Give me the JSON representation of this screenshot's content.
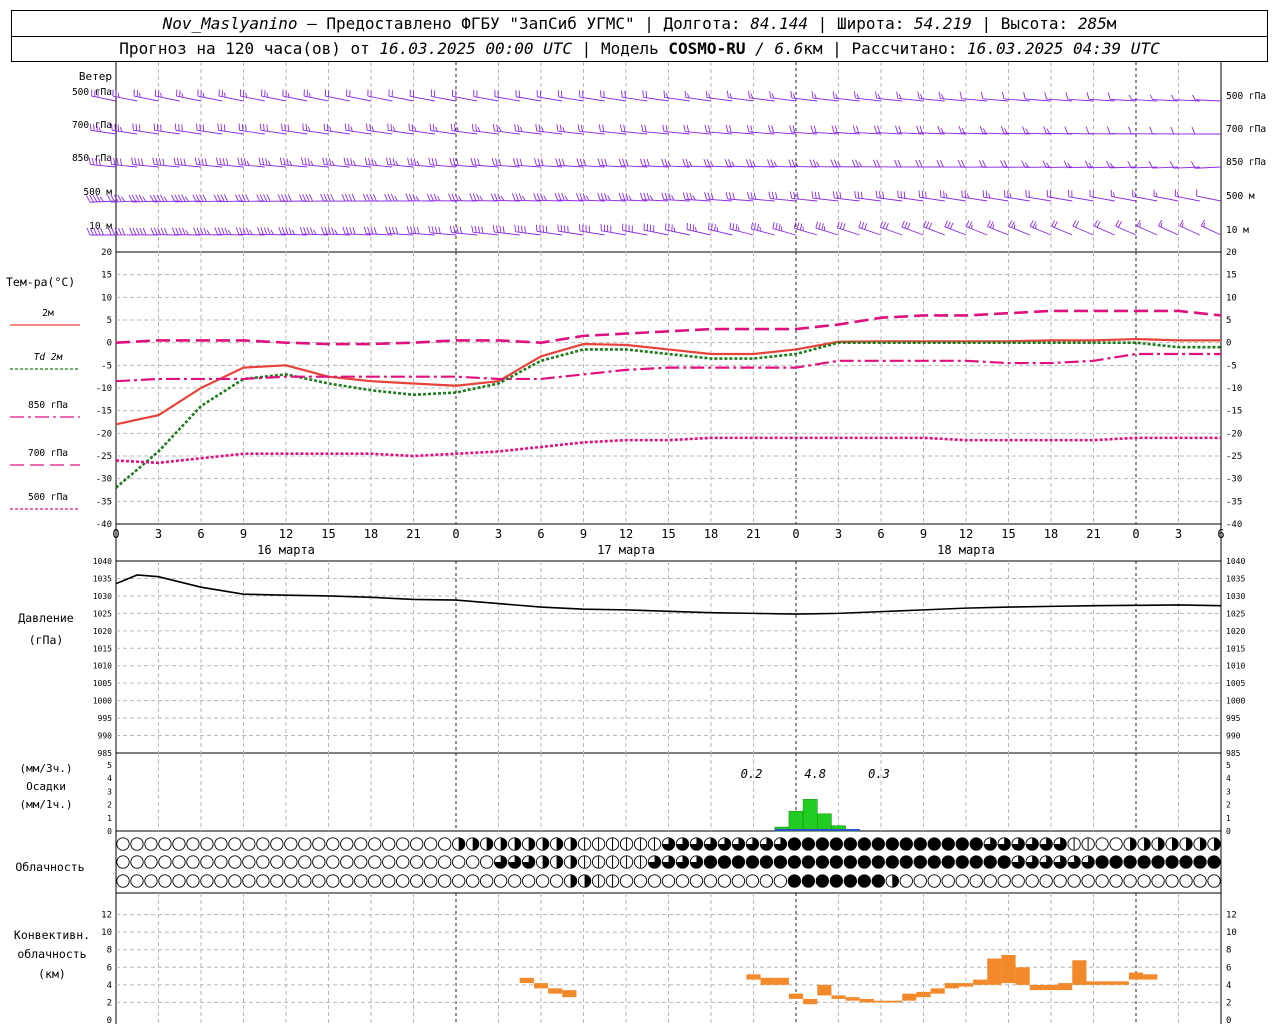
{
  "header": {
    "station": "Nov_Maslyanino",
    "provider": "Предоставлено ФГБУ \"ЗапСиб УГМС\"",
    "lon_label": "Долгота:",
    "lon_value": "84.144",
    "lat_label": "Широта:",
    "lat_value": "54.219",
    "alt_label": "Высота:",
    "alt_value": "285",
    "alt_unit": "м",
    "forecast_label": "Прогноз на 120 часа(ов) от",
    "forecast_start": "16.03.2025 00:00 UTC",
    "model_label": "Модель",
    "model_name": "COSMO-RU",
    "model_res": "/ 6.6",
    "model_res_unit": "км",
    "computed_label": "Рассчитано:",
    "computed_time": "16.03.2025 04:39 UTC"
  },
  "colors": {
    "wind": "#8a2be2",
    "t2m": "#e8433a",
    "td2m": "#1e7b1e",
    "t850": "#e0117f",
    "t700": "#e0117f",
    "t500": "#e0117f",
    "pressure": "#000000",
    "precip": "#22cc22",
    "precip_mm1h": "#3050d0",
    "convective": "#f28a2c",
    "grid": "#b8b8b8"
  },
  "chart_data": [
    {
      "type": "wind_barbs",
      "title": "Ветер",
      "levels": [
        "500 гПа",
        "700 гПа",
        "850 гПа",
        "500 м",
        "10 м"
      ],
      "time_step_hours": 1.5,
      "hours_range": [
        0,
        78
      ],
      "direction_deg": [
        [
          290,
          285,
          280,
          265,
          270
        ],
        [
          290,
          285,
          280,
          270,
          275
        ],
        [
          285,
          280,
          275,
          275,
          290
        ],
        [
          280,
          275,
          270,
          285,
          305
        ],
        [
          275,
          270,
          265,
          290,
          310
        ]
      ],
      "speed_ms": [
        [
          15,
          18,
          22,
          24,
          26
        ],
        [
          12,
          14,
          18,
          20,
          22
        ],
        [
          10,
          12,
          15,
          18,
          20
        ],
        [
          8,
          10,
          12,
          15,
          16
        ],
        [
          4,
          5,
          6,
          7,
          8
        ]
      ]
    },
    {
      "type": "line",
      "ylabel": "Тем-ра(°C)",
      "ylim": [
        -40,
        20
      ],
      "yticks": [
        20,
        15,
        10,
        5,
        0,
        -5,
        -10,
        -15,
        -20,
        -25,
        -30,
        -35,
        -40
      ],
      "x_tick_labels": [
        "0",
        "3",
        "6",
        "9",
        "12",
        "15",
        "18",
        "21",
        "0",
        "3",
        "6",
        "9",
        "12",
        "15",
        "18",
        "21",
        "0",
        "3",
        "6",
        "9",
        "12",
        "15",
        "18",
        "21",
        "0",
        "3",
        "6"
      ],
      "day_labels": [
        "16 марта",
        "17 марта",
        "18 марта"
      ],
      "x_hours": [
        0,
        3,
        6,
        9,
        12,
        15,
        18,
        21,
        24,
        27,
        30,
        33,
        36,
        39,
        42,
        45,
        48,
        51,
        54,
        57,
        60,
        63,
        66,
        69,
        72,
        75,
        78
      ],
      "series": [
        {
          "name": "2м",
          "values": [
            -18,
            -16,
            -10,
            -5.5,
            -5,
            -7.5,
            -8.5,
            -9,
            -9.5,
            -8.5,
            -3,
            -0.3,
            -0.5,
            -1.5,
            -2.5,
            -2.5,
            -1.5,
            0.2,
            0.3,
            0.3,
            0.3,
            0.3,
            0.5,
            0.5,
            0.8,
            0.5,
            0.5
          ]
        },
        {
          "name": "Td  2м",
          "values": [
            -32,
            -24,
            -14,
            -8,
            -7,
            -9,
            -10.5,
            -11.5,
            -11,
            -9,
            -4,
            -1.5,
            -1.5,
            -2.5,
            -3.5,
            -3.5,
            -2.5,
            0,
            0,
            0,
            0,
            0,
            0,
            0,
            0,
            -1,
            -1
          ]
        },
        {
          "name": "850 гПа",
          "values": [
            -8.5,
            -8,
            -8,
            -8,
            -7.5,
            -7.5,
            -7.5,
            -7.5,
            -7.5,
            -8,
            -8,
            -7,
            -6,
            -5.5,
            -5.5,
            -5.5,
            -5.5,
            -4,
            -4,
            -4,
            -4,
            -4.5,
            -4.5,
            -4,
            -2.5,
            -2.5,
            -2.5
          ]
        },
        {
          "name": "700 гПа",
          "values": [
            0,
            0.5,
            0.5,
            0.5,
            0,
            -0.3,
            -0.3,
            0,
            0.5,
            0.5,
            0,
            1.5,
            2,
            2.5,
            3,
            3,
            3,
            4,
            5.5,
            6,
            6,
            6.5,
            7,
            7,
            7,
            7,
            6
          ]
        },
        {
          "name": "500 гПа",
          "values": [
            -26,
            -26.5,
            -25.5,
            -24.5,
            -24.5,
            -24.5,
            -24.5,
            -25,
            -24.5,
            -24,
            -23,
            -22,
            -21.5,
            -21.5,
            -21,
            -21,
            -21,
            -21,
            -21,
            -21,
            -21.5,
            -21.5,
            -21.5,
            -21.5,
            -21,
            -21,
            -21
          ]
        }
      ]
    },
    {
      "type": "line",
      "ylabel": "Давление",
      "yunit": "(гПа)",
      "ylim": [
        985,
        1040
      ],
      "yticks": [
        1040,
        1035,
        1030,
        1025,
        1020,
        1015,
        1010,
        1005,
        1000,
        995,
        990,
        985
      ],
      "x_hours": [
        0,
        1.5,
        3,
        6,
        9,
        12,
        15,
        18,
        21,
        24,
        27,
        30,
        33,
        36,
        39,
        42,
        45,
        48,
        51,
        54,
        57,
        60,
        63,
        66,
        69,
        72,
        75,
        78
      ],
      "series": [
        {
          "name": "Давление",
          "values": [
            1033.5,
            1036,
            1035.5,
            1032.5,
            1030.5,
            1030.2,
            1030,
            1029.6,
            1029,
            1028.8,
            1027.8,
            1026.8,
            1026.2,
            1026,
            1025.6,
            1025.2,
            1025,
            1024.8,
            1025,
            1025.5,
            1026,
            1026.5,
            1026.8,
            1027,
            1027.2,
            1027.3,
            1027.4,
            1027.2
          ]
        }
      ]
    },
    {
      "type": "bar",
      "ylabel": "Осадки",
      "yunit_top": "(мм/3ч.)",
      "yunit_bottom": "(мм/1ч.)",
      "ylim": [
        0,
        5
      ],
      "yticks": [
        5,
        4,
        3,
        2,
        1,
        0
      ],
      "annotations": [
        "0.2",
        "4.8",
        "0.3"
      ],
      "x_hours": [
        47,
        48,
        49,
        50,
        51,
        52
      ],
      "values": [
        0.3,
        1.5,
        2.4,
        1.3,
        0.4,
        0.1
      ]
    },
    {
      "type": "cloud_symbols",
      "ylabel": "Облачность",
      "rows": 3,
      "time_step_hours": 1,
      "note": "0 clear, 4 overcast",
      "segments": [
        [
          [
            0,
            0,
            0
          ],
          [
            21,
            0,
            0
          ],
          [
            24,
            2,
            0
          ],
          [
            33,
            1,
            0
          ],
          [
            39,
            3,
            0
          ],
          [
            48,
            4,
            0
          ],
          [
            62,
            3,
            0
          ],
          [
            68,
            1,
            0
          ],
          [
            70,
            0,
            0
          ],
          [
            72,
            2,
            0
          ]
        ],
        [
          [
            0,
            0,
            0
          ],
          [
            27,
            3,
            0
          ],
          [
            30,
            2,
            0
          ],
          [
            33,
            1,
            0
          ],
          [
            38,
            3,
            0
          ],
          [
            42,
            4,
            0
          ],
          [
            64,
            3,
            0
          ],
          [
            70,
            4,
            0
          ]
        ],
        [
          [
            0,
            0,
            0
          ],
          [
            32,
            2,
            0
          ],
          [
            34,
            1,
            0
          ],
          [
            36,
            0,
            0
          ],
          [
            48,
            4,
            0
          ],
          [
            55,
            2,
            0
          ],
          [
            56,
            0,
            0
          ]
        ]
      ]
    },
    {
      "type": "bar",
      "ylabel": "Конвективн. облачность",
      "yunit": "(км)",
      "ylim": [
        0,
        14
      ],
      "yticks": [
        12,
        10,
        8,
        6,
        4,
        2,
        0
      ],
      "bars": [
        [
          29,
          4.2,
          4.8
        ],
        [
          30,
          3.6,
          4.2
        ],
        [
          31,
          3,
          3.6
        ],
        [
          32,
          2.6,
          3.4
        ],
        [
          45,
          4.6,
          5.2
        ],
        [
          46,
          4.0,
          4.8
        ],
        [
          47,
          4.0,
          4.8
        ],
        [
          48,
          2.4,
          3.0
        ],
        [
          49,
          1.8,
          2.4
        ],
        [
          50,
          2.8,
          4.0
        ],
        [
          51,
          2.4,
          2.8
        ],
        [
          52,
          2.2,
          2.6
        ],
        [
          53,
          2.0,
          2.4
        ],
        [
          54,
          2.0,
          2.2
        ],
        [
          55,
          2.0,
          2.2
        ],
        [
          56,
          2.2,
          3.0
        ],
        [
          57,
          2.6,
          3.2
        ],
        [
          58,
          3.0,
          3.6
        ],
        [
          59,
          3.6,
          4.2
        ],
        [
          60,
          3.8,
          4.2
        ],
        [
          61,
          4.0,
          4.6
        ],
        [
          62,
          4.0,
          7.0
        ],
        [
          63,
          4.2,
          7.4
        ],
        [
          64,
          4.0,
          6.0
        ],
        [
          65,
          3.4,
          4.0
        ],
        [
          66,
          3.4,
          4.0
        ],
        [
          67,
          3.4,
          4.2
        ],
        [
          68,
          4.0,
          6.8
        ],
        [
          69,
          4.0,
          4.4
        ],
        [
          70,
          4.0,
          4.4
        ],
        [
          71,
          4.0,
          4.4
        ],
        [
          72,
          4.6,
          5.4
        ],
        [
          73,
          4.6,
          5.2
        ]
      ]
    }
  ]
}
